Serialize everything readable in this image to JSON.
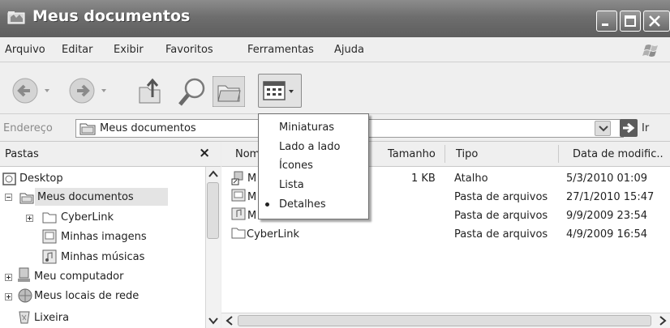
{
  "window": {
    "title": "Meus documentos"
  },
  "menu": {
    "items": [
      "Arquivo",
      "Editar",
      "Exibir",
      "Favoritos",
      "Ferramentas",
      "Ajuda"
    ]
  },
  "address": {
    "label": "Endereço",
    "value": "Meus documentos",
    "go_label": "Ir"
  },
  "folders_pane": {
    "title": "Pastas",
    "close_label": "×",
    "tree": [
      "Desktop",
      "Meus documentos",
      "CyberLink",
      "Minhas imagens",
      "Minhas músicas",
      "Meu computador",
      "Meus locais de rede",
      "Lixeira"
    ]
  },
  "views_menu": {
    "items": [
      "Miniaturas",
      "Lado a lado",
      "Ícones",
      "Lista",
      "Detalhes"
    ],
    "selected": "Detalhes"
  },
  "file_list": {
    "columns": [
      "Nom",
      "Tamanho",
      "Tipo",
      "Data de modific.."
    ],
    "rows": [
      {
        "name": "M",
        "size": "1 KB",
        "type": "Atalho",
        "date": "5/3/2010 01:09"
      },
      {
        "name": "M",
        "size": "",
        "type": "Pasta de arquivos",
        "date": "27/1/2010 15:47"
      },
      {
        "name": "M",
        "size": "",
        "type": "Pasta de arquivos",
        "date": "9/9/2009 23:54"
      },
      {
        "name": "CyberLink",
        "size": "",
        "type": "Pasta de arquivos",
        "date": "4/9/2009 16:54"
      }
    ]
  },
  "colors": {
    "titlebar": "#6e6e6e",
    "menu_bg": "#efefef",
    "selection": "#e4e4e4"
  },
  "icons": [
    "folder-window-icon",
    "minimize-icon",
    "maximize-icon",
    "close-icon",
    "windows-flag-icon",
    "back-icon",
    "forward-icon",
    "up-folder-icon",
    "search-icon",
    "folders-icon",
    "views-icon",
    "go-arrow-icon"
  ]
}
